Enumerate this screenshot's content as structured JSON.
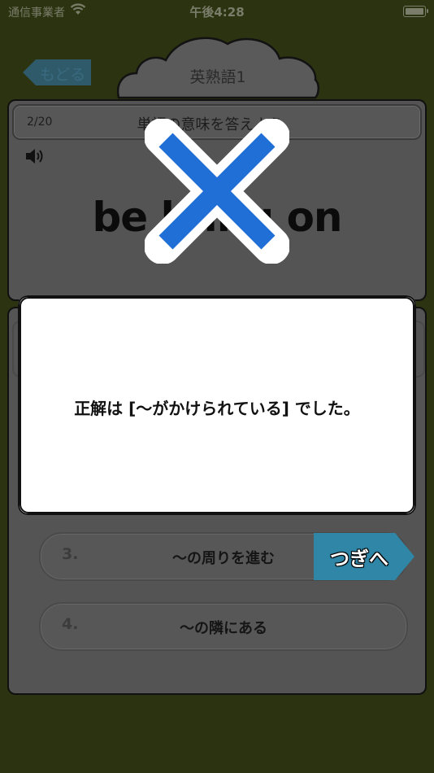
{
  "status_bar": {
    "carrier": "通信事業者",
    "time": "午後4:28"
  },
  "nav": {
    "back_label": "もどる",
    "title": "英熟語1"
  },
  "question": {
    "counter": "2/20",
    "prompt": "単語の意味を答えよう。",
    "word": "be hung on"
  },
  "options": [
    {
      "number": "3.",
      "label": "〜の周りを進む"
    },
    {
      "number": "4.",
      "label": "〜の隣にある"
    }
  ],
  "next_button": {
    "label": "つぎへ"
  },
  "result_dialog": {
    "message": "正解は [〜がかけられている] でした。"
  },
  "colors": {
    "background": "#2c3310",
    "next_button": "#2f86a6",
    "wrong_mark": "#1f6fd6"
  }
}
